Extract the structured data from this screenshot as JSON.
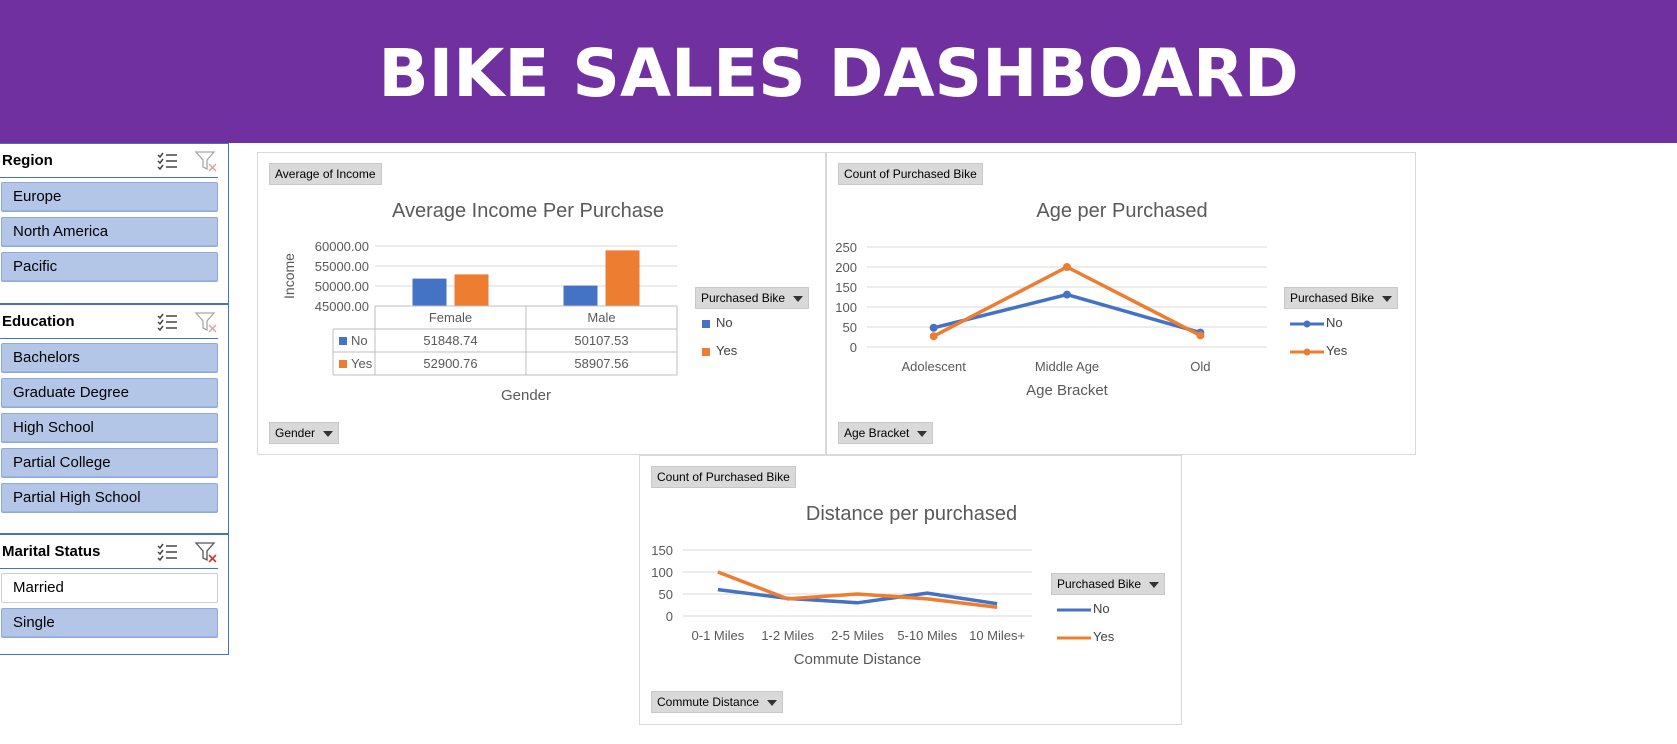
{
  "header": {
    "title": "BIKE SALES DASHBOARD"
  },
  "colors": {
    "header_bg": "#7030a0",
    "no": "#4472c4",
    "yes": "#ed7d31",
    "slicer_selected": "#b4c6e7"
  },
  "slicers": {
    "region": {
      "title": "Region",
      "items": [
        "Europe",
        "North America",
        "Pacific"
      ]
    },
    "education": {
      "title": "Education",
      "items": [
        "Bachelors",
        "Graduate Degree",
        "High School",
        "Partial College",
        "Partial High School"
      ]
    },
    "marital": {
      "title": "Marital Status",
      "items": [
        "Married",
        "Single"
      ],
      "selected": [
        false,
        true
      ]
    }
  },
  "icons": {
    "multi_select": "multi-select-icon",
    "clear_filter": "clear-filter-icon"
  },
  "income_panel": {
    "value_button": "Average of Income",
    "legend_button": "Purchased Bike",
    "axis_button": "Gender",
    "legend": [
      "No",
      "Yes"
    ]
  },
  "age_panel": {
    "value_button": "Count of Purchased Bike",
    "legend_button": "Purchased Bike",
    "axis_button": "Age Bracket",
    "legend": [
      "No",
      "Yes"
    ]
  },
  "distance_panel": {
    "value_button": "Count of Purchased Bike",
    "legend_button": "Purchased Bike",
    "axis_button": "Commute Distance",
    "legend": [
      "No",
      "Yes"
    ]
  },
  "chart_data": [
    {
      "type": "bar",
      "title": "Average Income Per Purchase",
      "xlabel": "Gender",
      "ylabel": "Income",
      "categories": [
        "Female",
        "Male"
      ],
      "series": [
        {
          "name": "No",
          "values": [
            51848.74,
            50107.53
          ],
          "labels": [
            "51848.74",
            "50107.53"
          ]
        },
        {
          "name": "Yes",
          "values": [
            52900.76,
            58907.56
          ],
          "labels": [
            "52900.76",
            "58907.56"
          ]
        }
      ],
      "ylim": [
        45000,
        60000
      ],
      "yticks": [
        45000,
        50000,
        55000,
        60000
      ],
      "ytick_labels": [
        "45000.00",
        "50000.00",
        "55000.00",
        "60000.00"
      ],
      "data_table": true,
      "grid": true
    },
    {
      "type": "line",
      "title": "Age per Purchased",
      "xlabel": "Age Bracket",
      "ylabel": "",
      "categories": [
        "Adolescent",
        "Middle Age",
        "Old"
      ],
      "series": [
        {
          "name": "No",
          "values": [
            48,
            131,
            36
          ]
        },
        {
          "name": "Yes",
          "values": [
            27,
            200,
            29
          ]
        }
      ],
      "ylim": [
        0,
        250
      ],
      "yticks": [
        0,
        50,
        100,
        150,
        200,
        250
      ],
      "markers": true,
      "grid": true
    },
    {
      "type": "line",
      "title": "Distance per purchased",
      "xlabel": "Commute Distance",
      "ylabel": "",
      "categories": [
        "0-1 Miles",
        "1-2 Miles",
        "2-5 Miles",
        "5-10 Miles",
        "10 Miles+"
      ],
      "series": [
        {
          "name": "No",
          "values": [
            60,
            40,
            30,
            52,
            28
          ]
        },
        {
          "name": "Yes",
          "values": [
            100,
            39,
            50,
            39,
            20
          ]
        }
      ],
      "ylim": [
        0,
        150
      ],
      "yticks": [
        0,
        50,
        100,
        150
      ],
      "markers": false,
      "grid": true
    }
  ]
}
